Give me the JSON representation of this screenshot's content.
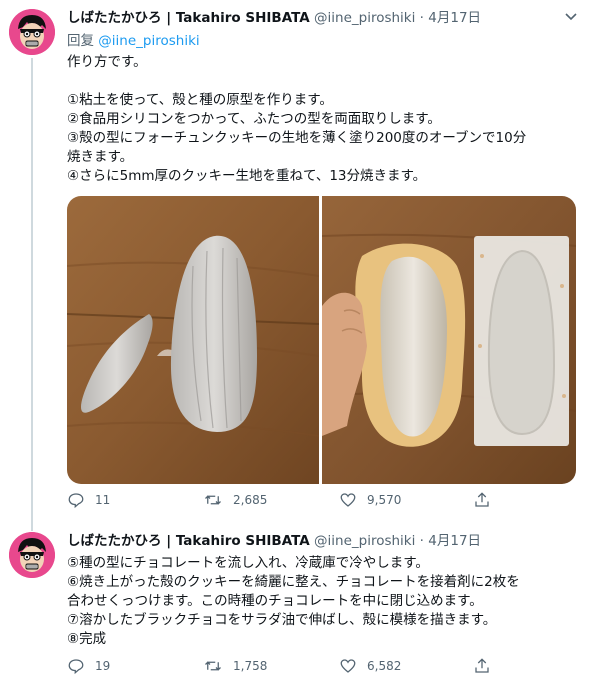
{
  "tweets": [
    {
      "display_name": "しばたたかひろ | Takahiro SHIBATA",
      "handle": "@iine_piroshiki",
      "separator": "·",
      "date": "4月17日",
      "reply_prefix": "回复",
      "reply_handle": "@iine_piroshiki",
      "lines": [
        "作り方です。",
        "",
        "①粘土を使って、殻と種の原型を作ります。",
        "②食品用シリコンをつかって、ふたつの型を両面取りします。",
        "③殻の型にフォーチュンクッキーの生地を薄く塗り200度のオーブンで10分",
        "焼きます。",
        "④さらに5mm厚のクッキー生地を重ねて、13分焼きます。"
      ],
      "images": [
        {
          "name": "clay-originals-photo",
          "alt": ""
        },
        {
          "name": "silicone-molds-photo",
          "alt": ""
        }
      ],
      "actions": {
        "replies": "11",
        "retweets": "2,685",
        "likes": "9,570"
      }
    },
    {
      "display_name": "しばたたかひろ | Takahiro SHIBATA",
      "handle": "@iine_piroshiki",
      "separator": "·",
      "date": "4月17日",
      "lines": [
        "⑤種の型にチョコレートを流し入れ、冷蔵庫で冷やします。",
        "⑥焼き上がった殻のクッキーを綺麗に整え、チョコレートを接着剤に2枚を",
        "合わせくっつけます。この時種のチョコレートを中に閉じ込めます。",
        "⑦溶かしたブラックチョコをサラダ油で伸ばし、殻に模様を描きます。",
        "⑧完成"
      ],
      "actions": {
        "replies": "19",
        "retweets": "1,758",
        "likes": "6,582"
      }
    }
  ],
  "icons": {
    "reply": "reply-icon",
    "retweet": "retweet-icon",
    "like": "heart-icon",
    "share": "share-icon",
    "more": "chevron-down-icon"
  },
  "colors": {
    "text": "#0f1419",
    "secondary": "#536471",
    "link": "#1d9bf0",
    "avatar_bg": "#e8488d",
    "thread_line": "#cfd9de"
  }
}
